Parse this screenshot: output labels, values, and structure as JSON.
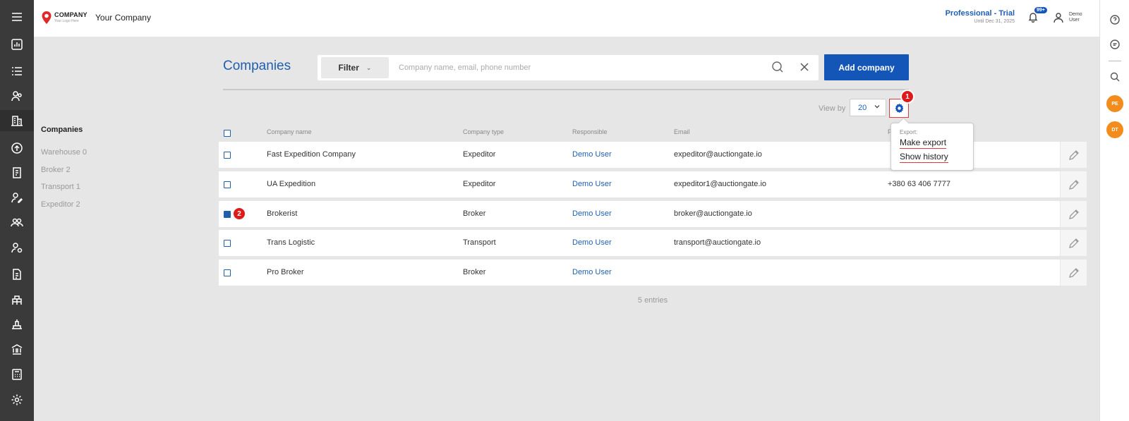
{
  "header": {
    "logo_main": "COMPANY",
    "logo_sub": "Your Logo Here",
    "company_name": "Your Company",
    "plan_title": "Professional - Trial",
    "plan_until": "Until Dec 31, 2025",
    "notifications_badge": "99+",
    "user_name": "Demo User"
  },
  "sidebar": {
    "title": "Companies",
    "items": [
      {
        "label": "Warehouse 0"
      },
      {
        "label": "Broker 2"
      },
      {
        "label": "Transport 1"
      },
      {
        "label": "Expeditor 2"
      }
    ]
  },
  "toolbar": {
    "page_title": "Companies",
    "filter_label": "Filter",
    "search_placeholder": "Company name, email, phone number",
    "add_label": "Add company",
    "view_by_label": "View by",
    "view_by_value": "20"
  },
  "table": {
    "columns": [
      "Company name",
      "Company type",
      "Responsible",
      "Email",
      "P"
    ],
    "rows": [
      {
        "name": "Fast Expedition Company",
        "type": "Expeditor",
        "responsible": "Demo User",
        "email": "expeditor@auctiongate.io",
        "phone": "",
        "checked": false
      },
      {
        "name": "UA Expedition",
        "type": "Expeditor",
        "responsible": "Demo User",
        "email": "expeditor1@auctiongate.io",
        "phone": "+380 63 406 7777",
        "checked": false
      },
      {
        "name": "Brokerist",
        "type": "Broker",
        "responsible": "Demo User",
        "email": "broker@auctiongate.io",
        "phone": "",
        "checked": true
      },
      {
        "name": "Trans Logistic",
        "type": "Transport",
        "responsible": "Demo User",
        "email": "transport@auctiongate.io",
        "phone": "",
        "checked": false
      },
      {
        "name": "Pro Broker",
        "type": "Broker",
        "responsible": "Demo User",
        "email": "",
        "phone": "",
        "checked": false
      }
    ],
    "entries_text": "5 entries"
  },
  "export_menu": {
    "header": "Export:",
    "items": [
      "Make export",
      "Show history"
    ]
  },
  "badges": {
    "one": "1",
    "two": "2"
  },
  "right_rail": {
    "avatar1": "PE",
    "avatar2": "DT"
  },
  "colors": {
    "accent": "#1456b8",
    "link": "#1f5fb0",
    "highlight": "#e23a3a",
    "avatar": "#f28c1c"
  }
}
